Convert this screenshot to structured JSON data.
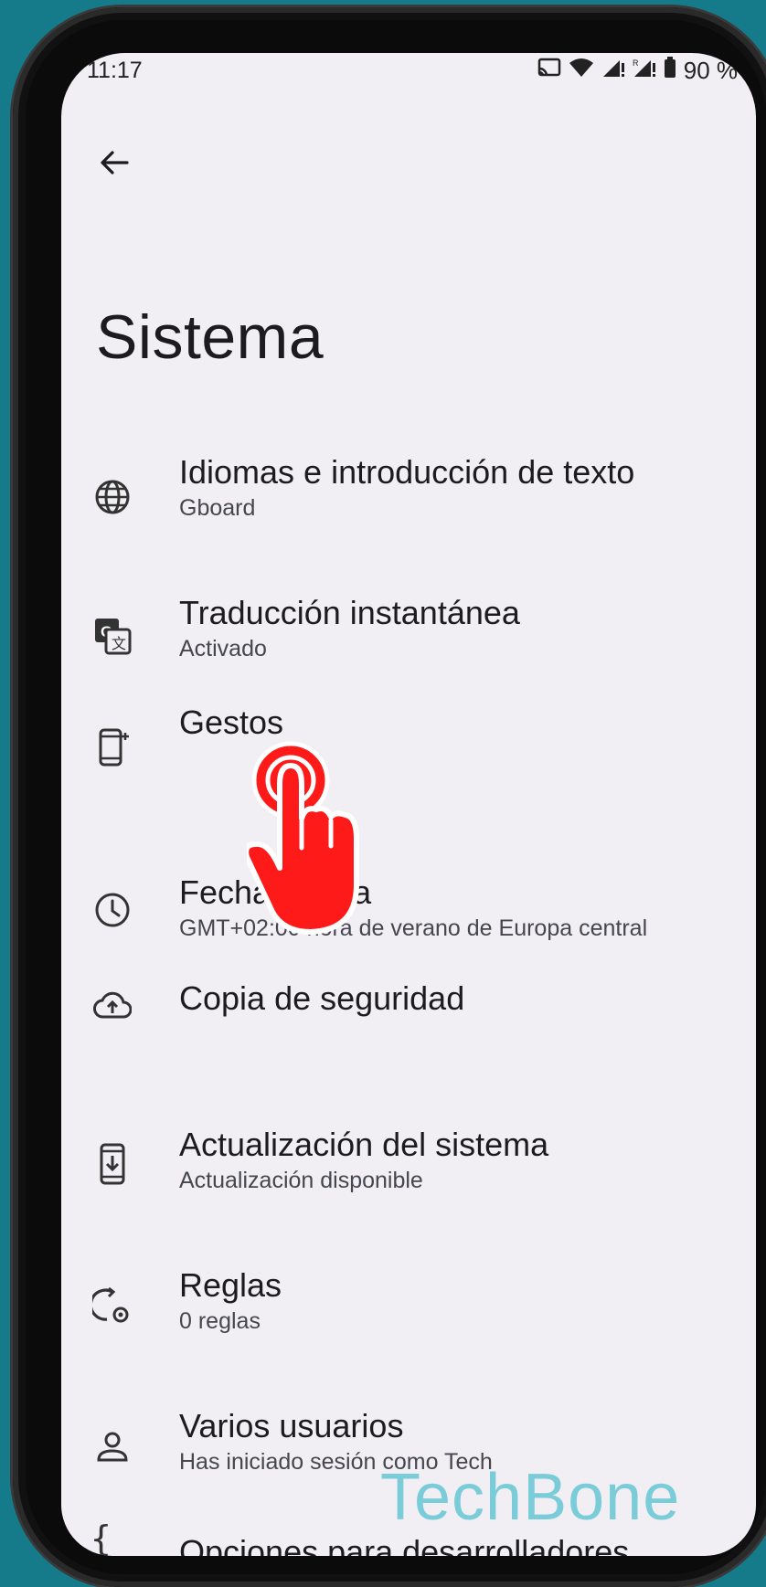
{
  "status": {
    "time": "11:17",
    "battery": "90 %"
  },
  "page": {
    "title": "Sistema"
  },
  "items": [
    {
      "label": "Idiomas e introducción de texto",
      "sub": "Gboard",
      "icon": "globe-icon"
    },
    {
      "label": "Traducción instantánea",
      "sub": "Activado",
      "icon": "translate-icon"
    },
    {
      "label": "Gestos",
      "sub": "",
      "icon": "gestures-phone-icon"
    },
    {
      "label": "Fecha y hora",
      "sub": "GMT+02:00 hora de verano de Europa central",
      "icon": "clock-icon"
    },
    {
      "label": "Copia de seguridad",
      "sub": "",
      "icon": "cloud-upload-icon"
    },
    {
      "label": "Actualización del sistema",
      "sub": "Actualización disponible",
      "icon": "system-update-icon"
    },
    {
      "label": "Reglas",
      "sub": "0 reglas",
      "icon": "rules-icon"
    },
    {
      "label": "Varios usuarios",
      "sub": "Has iniciado sesión como Tech",
      "icon": "person-icon"
    },
    {
      "label": "Opciones para desarrolladores",
      "sub": "",
      "icon": "braces-icon"
    }
  ],
  "watermark": "TechBone",
  "colors": {
    "background": "#157a8a",
    "screen": "#f1eff4",
    "tap": "#ff1a1a",
    "watermark": "#6ec9d6"
  }
}
